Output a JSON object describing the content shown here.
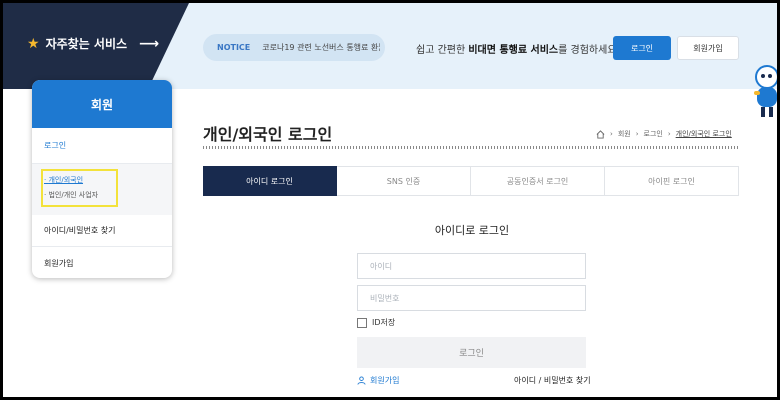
{
  "header": {
    "quick_service": "자주찾는 서비스",
    "notice_label": "NOTICE",
    "notice_text": "코로나19 관련 노선버스 통행료 환불...",
    "slogan_pre": "쉽고 간편한 ",
    "slogan_bold": "비대면 통행료 서비스",
    "slogan_post": "를 경험하세요",
    "login_button": "로그인",
    "join_button": "회원가입"
  },
  "sidebar": {
    "title": "회원",
    "login": "로그인",
    "sub_items": [
      "개인/외국인",
      "법인/개인 사업자"
    ],
    "find_id_pw": "아이디/비밀번호 찾기",
    "join": "회원가입"
  },
  "main": {
    "title": "개인/외국인 로그인",
    "breadcrumb": [
      "회원",
      "로그인",
      "개인/외국인 로그인"
    ],
    "tabs": [
      "아이디 로그인",
      "SNS 인증",
      "공동인증서 로그인",
      "아이핀 로그인"
    ],
    "active_tab": 0,
    "form": {
      "title": "아이디로 로그인",
      "id_placeholder": "아이디",
      "pw_placeholder": "비밀번호",
      "save_id": "ID저장",
      "submit": "로그인",
      "join_link": "회원가입",
      "find_link": "아이디 / 비밀번호 찾기"
    }
  },
  "colors": {
    "accent": "#1e79d1",
    "dark_navy": "#182a4e",
    "top_band": "#e6f1fa",
    "highlight": "#f3e23b"
  },
  "icons": [
    "star-icon",
    "arrow-right-icon",
    "home-icon",
    "chevron-right-icon",
    "user-icon",
    "mascot-icon"
  ]
}
